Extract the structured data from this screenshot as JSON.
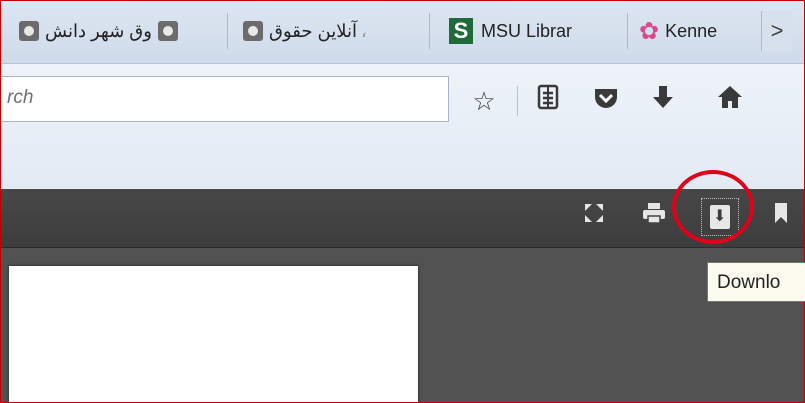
{
  "bookmarks": [
    {
      "label": "وق شهر دانش",
      "icon": "site-favicon"
    },
    {
      "label": "آنلاین حقوق",
      "icon": "site-favicon",
      "prefix": "،"
    },
    {
      "label": "MSU Librar",
      "icon": "msu-s-logo",
      "icon_text": "S"
    },
    {
      "label": "Kenne",
      "icon": "kenne-flower-logo"
    }
  ],
  "bookmarks_more_glyph": ">",
  "search": {
    "value": "rch"
  },
  "toolbar_icons": [
    "bookmark-star-icon",
    "reading-list-icon",
    "pocket-icon",
    "downloads-icon",
    "home-icon"
  ],
  "viewer_toolbar_icons": [
    "fullscreen-icon",
    "print-icon",
    "download-icon",
    "bookmark-icon"
  ],
  "tooltip": {
    "text": "Downlo"
  },
  "colors": {
    "highlight_circle": "#e1001a",
    "viewer_toolbar": "#434343",
    "viewer_bg": "#525252",
    "msu_green": "#1f6b3a"
  }
}
